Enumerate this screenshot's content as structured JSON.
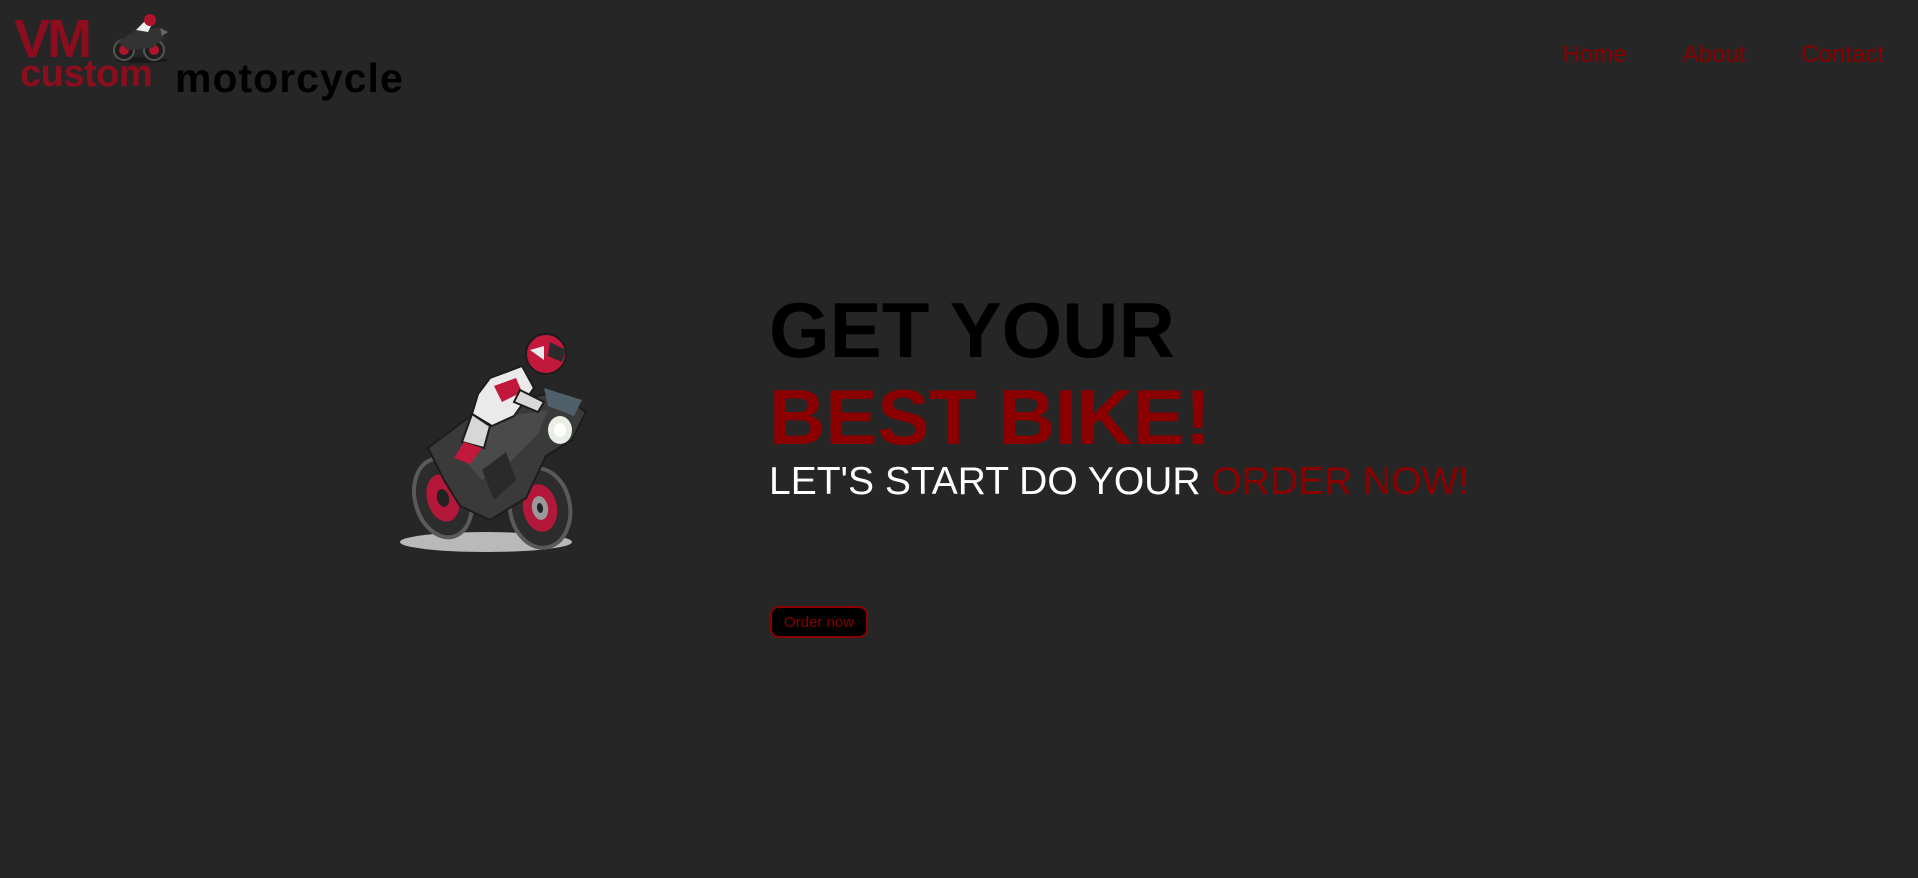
{
  "header": {
    "logo": {
      "vm_text": "VM",
      "custom_text": "custom",
      "motorcycle_text": "motorcycle"
    },
    "nav": [
      {
        "label": "Home"
      },
      {
        "label": "About"
      },
      {
        "label": "Contact"
      }
    ]
  },
  "hero": {
    "title_line1": "GET YOUR",
    "title_line2": "BEST BIKE!",
    "subtitle_plain": "LET'S START DO YOUR ",
    "subtitle_accent": "ORDER NOW!",
    "image_icon": "motorcycle-rider-icon",
    "cta_label": "Order now"
  },
  "colors": {
    "background": "#262626",
    "accent": "#8b0000",
    "logo_red": "#8b0d1e",
    "text_dark": "#000000",
    "text_light": "#ffffff"
  }
}
